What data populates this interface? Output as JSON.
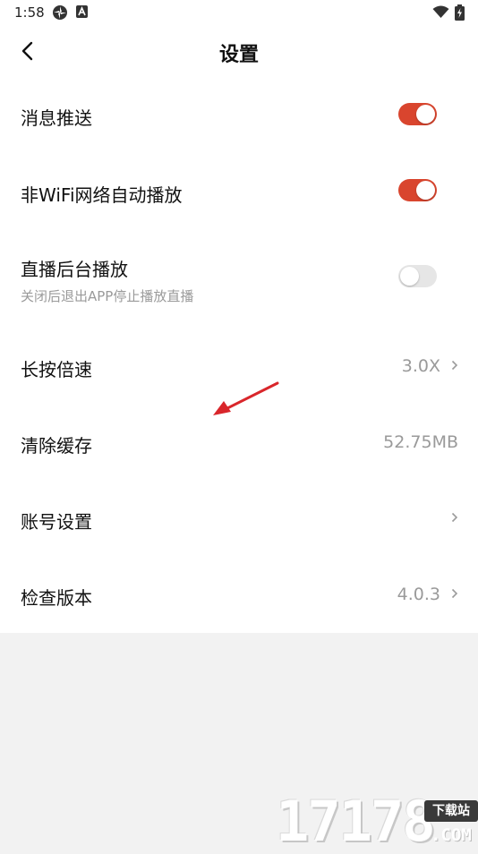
{
  "status_bar": {
    "time": "1:58",
    "icons": [
      "settings-flower-icon",
      "a-badge-icon",
      "wifi-icon",
      "battery-charging-icon"
    ]
  },
  "header": {
    "title": "设置",
    "back_icon": "chevron-left-icon"
  },
  "settings": {
    "push": {
      "label": "消息推送",
      "toggle": "on"
    },
    "wifi_autoplay": {
      "label": "非WiFi网络自动播放",
      "toggle": "on"
    },
    "background_play": {
      "label": "直播后台播放",
      "subtitle": "关闭后退出APP停止播放直播",
      "toggle": "off"
    },
    "long_press_speed": {
      "label": "长按倍速",
      "value": "3.0X"
    },
    "clear_cache": {
      "label": "清除缓存",
      "value": "52.75MB"
    },
    "account": {
      "label": "账号设置"
    },
    "check_version": {
      "label": "检查版本",
      "value": "4.0.3"
    }
  },
  "watermark": {
    "digits": "17178",
    "badge": "下载站",
    "domain": ".COM"
  },
  "colors": {
    "accent": "#d9452e",
    "toggle_off": "#e6e6e6",
    "secondary_text": "#9a9a9a",
    "page_bg": "#f2f2f2",
    "annotation_arrow": "#d9262b"
  }
}
